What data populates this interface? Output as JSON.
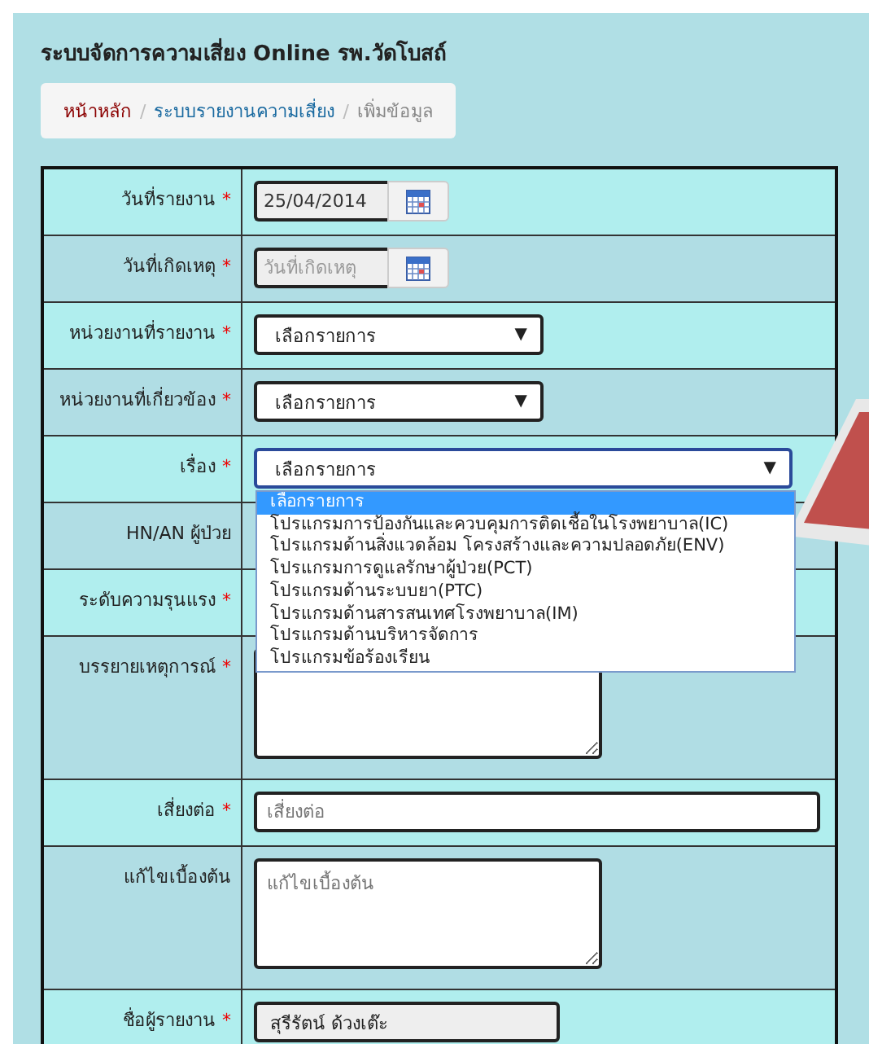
{
  "title": "ระบบจัดการความเสี่ยง Online รพ.วัดโบสถ์",
  "breadcrumb": [
    {
      "label": "หน้าหลัก",
      "kind": "home"
    },
    {
      "separator": "/",
      "label": "ระบบรายงานความเสี่ยง",
      "kind": "link"
    },
    {
      "separator": "/",
      "label": "เพิ่มข้อมูล",
      "kind": "current"
    }
  ],
  "form": [
    {
      "label": "วันที่รายงาน",
      "required_mark": "*",
      "kind": "date",
      "value": "25/04/2014"
    },
    {
      "label": "วันที่เกิดเหตุ",
      "required_mark": "*",
      "kind": "date",
      "placeholder": "วันที่เกิดเหตุ"
    },
    {
      "label": "หน่วยงานที่รายงาน",
      "required_mark": "*",
      "kind": "select",
      "value": "เลือกรายการ",
      "caret": "▼"
    },
    {
      "label": "หน่วยงานที่เกี่ยวข้อง",
      "required_mark": "*",
      "kind": "select",
      "value": "เลือกรายการ",
      "caret": "▼"
    },
    {
      "label": "เรื่อง",
      "required_mark": "*",
      "kind": "select-wide",
      "value": "เลือกรายการ",
      "caret": "▼",
      "expanded": true,
      "options": [
        {
          "label": "เลือกรายการ",
          "selected": true
        },
        {
          "label": "โปรแกรมการป้องกันและควบคุมการติดเชื้อในโรงพยาบาล(IC)",
          "selected": false
        },
        {
          "label": "โปรแกรมด้านสิ่งแวดล้อม โครงสร้างและความปลอดภัย(ENV)",
          "selected": false
        },
        {
          "label": "โปรแกรมการดูแลรักษาผู้ป่วย(PCT)",
          "selected": false
        },
        {
          "label": "โปรแกรมด้านระบบยา(PTC)",
          "selected": false
        },
        {
          "label": "โปรแกรมด้านสารสนเทศโรงพยาบาล(IM)",
          "selected": false
        },
        {
          "label": "โปรแกรมด้านบริหารจัดการ",
          "selected": false
        },
        {
          "label": "โปรแกรมข้อร้องเรียน",
          "selected": false
        }
      ]
    },
    {
      "label": "HN/AN ผู้ป่วย",
      "kind": "hidden"
    },
    {
      "label": "ระดับความรุนแรง",
      "required_mark": "*",
      "kind": "hidden"
    },
    {
      "label": "บรรยายเหตุการณ์",
      "required_mark": "*",
      "kind": "textarea"
    },
    {
      "label": "เสี่ยงต่อ",
      "required_mark": "*",
      "kind": "text",
      "placeholder": "เสี่ยงต่อ"
    },
    {
      "label": "แก้ไขเบื้องต้น",
      "kind": "textarea",
      "placeholder": "แก้ไขเบื้องต้น"
    },
    {
      "label": "ชื่อผู้รายงาน",
      "required_mark": "*",
      "kind": "readonly",
      "value": "สุรีรัตน์ ด้วงเต๊ะ"
    }
  ]
}
